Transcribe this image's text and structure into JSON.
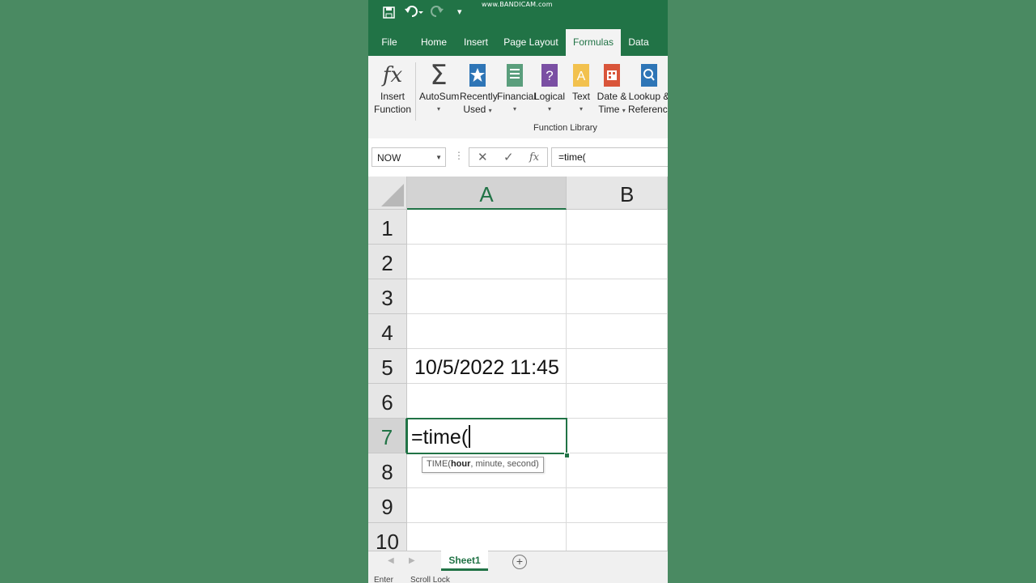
{
  "watermark": "www.BANDICAM.com",
  "tabs": [
    {
      "label": "File",
      "active": false
    },
    {
      "label": "Home",
      "active": false
    },
    {
      "label": "Insert",
      "active": false
    },
    {
      "label": "Page Layout",
      "active": false
    },
    {
      "label": "Formulas",
      "active": true
    },
    {
      "label": "Data",
      "active": false
    }
  ],
  "ribbon": {
    "buttons": [
      {
        "line1": "Insert",
        "line2": "Function",
        "icon": "insert-function-icon"
      },
      {
        "line1": "AutoSum",
        "line2": "",
        "icon": "sigma-icon"
      },
      {
        "line1": "Recently",
        "line2": "Used",
        "icon": "recently-used-icon"
      },
      {
        "line1": "Financial",
        "line2": "",
        "icon": "financial-icon"
      },
      {
        "line1": "Logical",
        "line2": "",
        "icon": "logical-icon"
      },
      {
        "line1": "Text",
        "line2": "",
        "icon": "text-icon"
      },
      {
        "line1": "Date &",
        "line2": "Time",
        "icon": "date-time-icon"
      },
      {
        "line1": "Lookup &",
        "line2": "Reference",
        "icon": "lookup-reference-icon"
      }
    ],
    "group_label": "Function Library"
  },
  "formula_bar": {
    "name_box": "NOW",
    "formula": "=time("
  },
  "columns": [
    "A",
    "B"
  ],
  "rows": [
    "1",
    "2",
    "3",
    "4",
    "5",
    "6",
    "7",
    "8",
    "9",
    "10"
  ],
  "cells": {
    "A5": "10/5/2022 11:45",
    "A7": "=time("
  },
  "tooltip": {
    "fn": "TIME(",
    "bold_arg": "hour",
    "rest": ", minute, second)"
  },
  "sheet_tab": "Sheet1",
  "status": {
    "mode": "Enter",
    "indicator": "Scroll Lock"
  },
  "colors": {
    "excel_green": "#217346",
    "background": "#4a8a62"
  }
}
